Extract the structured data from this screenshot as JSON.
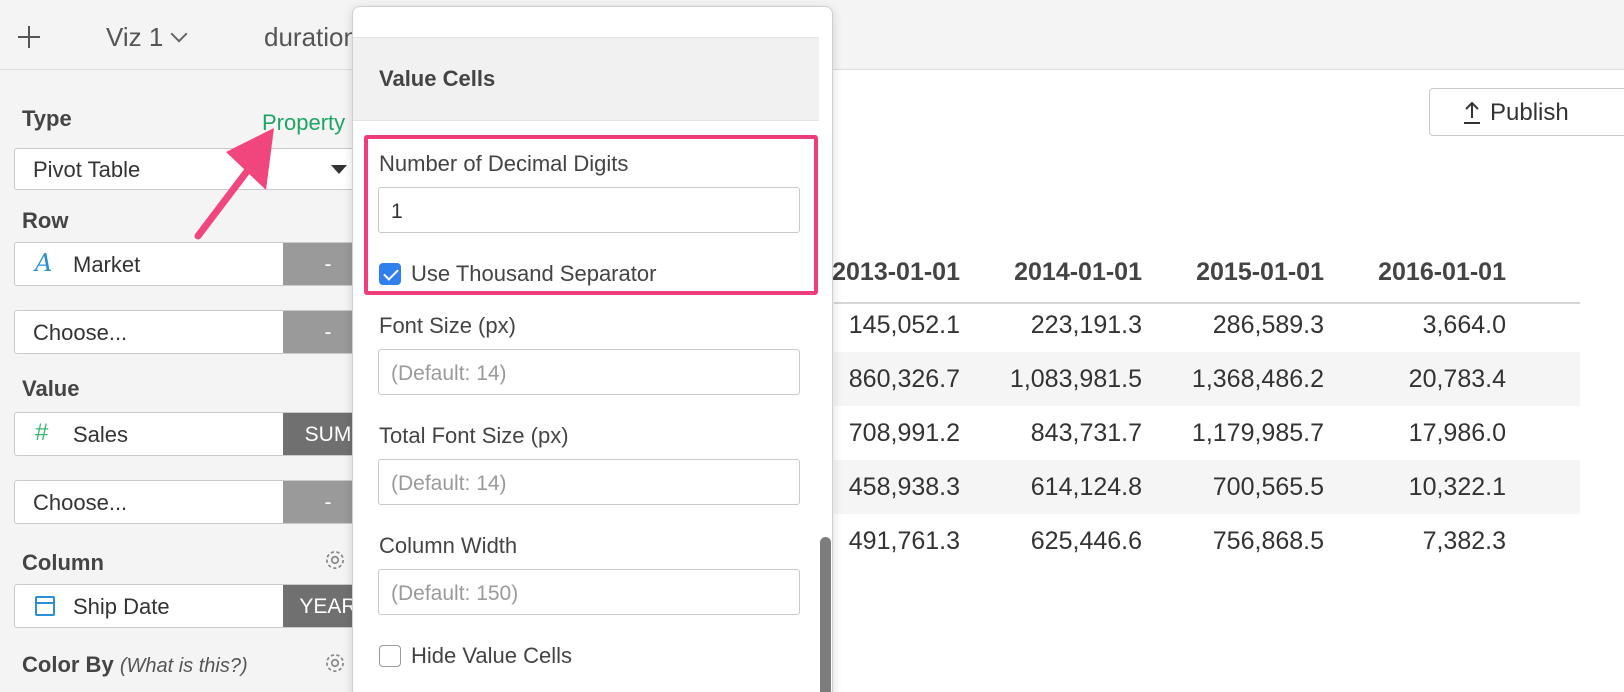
{
  "tabs": {
    "viz1_label": "Viz 1",
    "duration_label": "duration"
  },
  "left_panel": {
    "type_label": "Type",
    "property_link": "Property",
    "type_value": "Pivot Table",
    "row_label": "Row",
    "row_field": "Market",
    "row_field_agg": "-",
    "row_choose": "Choose...",
    "row_choose_agg": "-",
    "value_label": "Value",
    "value_field": "Sales",
    "value_field_agg": "SUM",
    "value_choose": "Choose...",
    "value_choose_agg": "-",
    "column_label": "Column",
    "column_field": "Ship Date",
    "column_field_agg": "YEAR",
    "color_by_label": "Color By",
    "color_by_hint": "(What is this?)"
  },
  "publish_label": "Publish",
  "pivot": {
    "headers": [
      "2013-01-01",
      "2014-01-01",
      "2015-01-01",
      "2016-01-01"
    ],
    "rows": [
      [
        "145,052.1",
        "223,191.3",
        "286,589.3",
        "3,664.0"
      ],
      [
        "860,326.7",
        "1,083,981.5",
        "1,368,486.2",
        "20,783.4"
      ],
      [
        "708,991.2",
        "843,731.7",
        "1,179,985.7",
        "17,986.0"
      ],
      [
        "458,938.3",
        "614,124.8",
        "700,565.5",
        "10,322.1"
      ],
      [
        "491,761.3",
        "625,446.6",
        "756,868.5",
        "7,382.3"
      ]
    ]
  },
  "popup": {
    "section_title": "Value Cells",
    "decimal_label": "Number of Decimal Digits",
    "decimal_value": "1",
    "thousand_label": "Use Thousand Separator",
    "font_size_label": "Font Size (px)",
    "font_size_placeholder": "(Default: 14)",
    "total_font_size_label": "Total Font Size (px)",
    "total_font_size_placeholder": "(Default: 14)",
    "column_width_label": "Column Width",
    "column_width_placeholder": "(Default: 150)",
    "hide_value_cells_label": "Hide Value Cells"
  },
  "colors": {
    "property_green": "#1fa463",
    "highlight_pink": "#ef3e77",
    "checkbox_blue": "#2f80ed"
  }
}
